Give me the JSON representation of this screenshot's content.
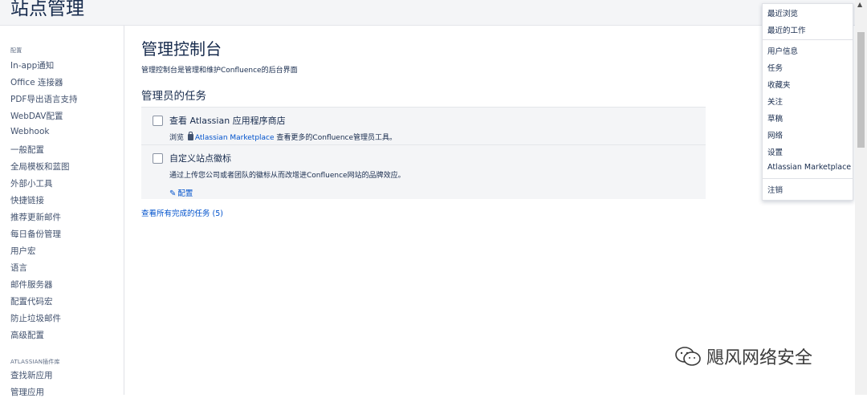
{
  "header": {
    "site_title": "站点管理"
  },
  "sidebar": {
    "section_config": "配置",
    "items": [
      "In-app通知",
      "Office 连接器",
      "PDF导出语言支持",
      "WebDAV配置",
      "Webhook",
      "一般配置",
      "全局模板和蓝图",
      "外部小工具",
      "快捷链接",
      "推荐更新邮件",
      "每日备份管理",
      "用户宏",
      "语言",
      "邮件服务器",
      "配置代码宏",
      "防止垃圾邮件",
      "高级配置"
    ],
    "section_atlassian": "ATLASSIAN插件库",
    "atlassian_items": [
      "查找新应用",
      "管理应用"
    ]
  },
  "main": {
    "title": "管理控制台",
    "description": "管理控制台是管理和维护Confluence的后台界面",
    "tasks_heading": "管理员的任务",
    "tasks": [
      {
        "title": "查看 Atlassian 应用程序商店",
        "desc_prefix": "浏览",
        "link": "Atlassian Marketplace",
        "desc_suffix": "查看更多的Confluence管理员工具。"
      },
      {
        "title": "自定义站点徽标",
        "desc": "通过上传您公司或者团队的徽标从而改增进Confluence网站的品牌效应。",
        "action": "配置"
      }
    ],
    "view_all": "查看所有完成的任务 (5)"
  },
  "user_menu": {
    "items": [
      "最近浏览",
      "最近的工作",
      "用户信息",
      "任务",
      "收藏夹",
      "关注",
      "草稿",
      "网络",
      "设置",
      "Atlassian Marketplace",
      "注销"
    ]
  },
  "watermark": {
    "text": "飓风网络安全"
  }
}
